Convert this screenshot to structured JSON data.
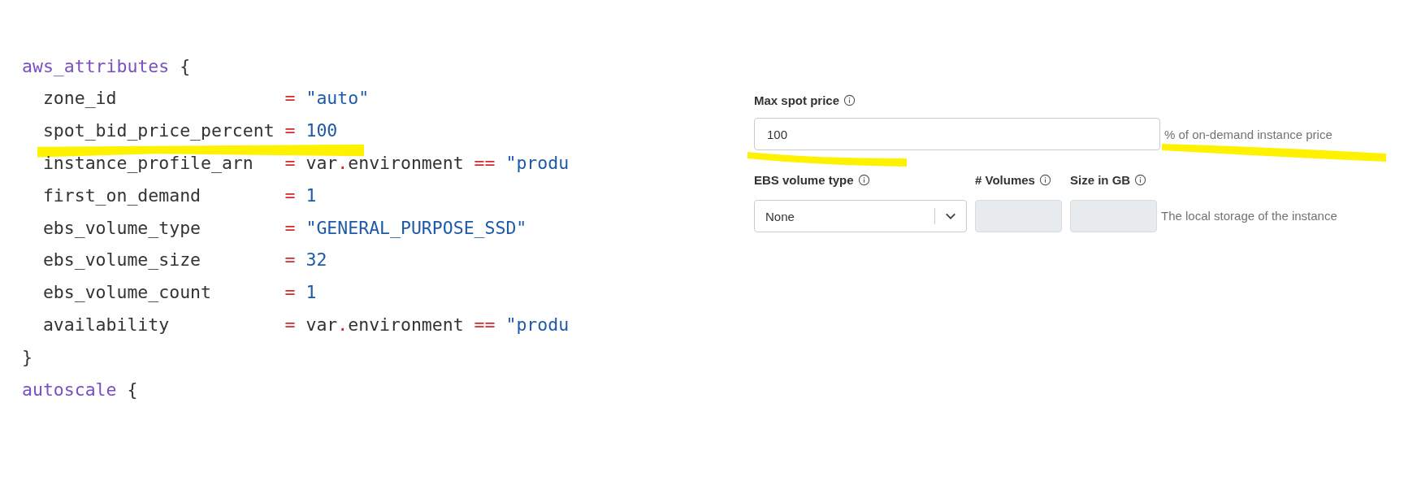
{
  "code": {
    "lines": [
      {
        "kind": "block_open",
        "name": "aws_attributes",
        "brace": "{"
      },
      {
        "kind": "attr",
        "key": "zone_id",
        "op": "=",
        "value": [
          {
            "kind": "string",
            "text": "\"auto\""
          }
        ]
      },
      {
        "kind": "attr",
        "key": "spot_bid_price_percent",
        "op": "=",
        "value": [
          {
            "kind": "number",
            "text": "100"
          }
        ]
      },
      {
        "kind": "attr",
        "key": "instance_profile_arn",
        "op": "=",
        "value": [
          {
            "kind": "plain",
            "text": "var"
          },
          {
            "kind": "operator",
            "text": "."
          },
          {
            "kind": "plain",
            "text": "environment "
          },
          {
            "kind": "operator",
            "text": "=="
          },
          {
            "kind": "string",
            "text": " \"produ"
          }
        ]
      },
      {
        "kind": "attr",
        "key": "first_on_demand",
        "op": "=",
        "value": [
          {
            "kind": "number",
            "text": "1"
          }
        ]
      },
      {
        "kind": "attr",
        "key": "ebs_volume_type",
        "op": "=",
        "value": [
          {
            "kind": "string",
            "text": "\"GENERAL_PURPOSE_SSD\""
          }
        ]
      },
      {
        "kind": "attr",
        "key": "ebs_volume_size",
        "op": "=",
        "value": [
          {
            "kind": "number",
            "text": "32"
          }
        ]
      },
      {
        "kind": "attr",
        "key": "ebs_volume_count",
        "op": "=",
        "value": [
          {
            "kind": "number",
            "text": "1"
          }
        ]
      },
      {
        "kind": "attr",
        "key": "availability",
        "op": "=",
        "value": [
          {
            "kind": "plain",
            "text": "var"
          },
          {
            "kind": "operator",
            "text": "."
          },
          {
            "kind": "plain",
            "text": "environment "
          },
          {
            "kind": "operator",
            "text": "=="
          },
          {
            "kind": "string",
            "text": " \"produ"
          }
        ]
      },
      {
        "kind": "block_close",
        "brace": "}"
      },
      {
        "kind": "block_open",
        "name": "autoscale",
        "brace": "{"
      }
    ]
  },
  "form": {
    "max_spot_price": {
      "label": "Max spot price",
      "value": "100",
      "suffix": "% of on-demand instance price"
    },
    "ebs_volume_type": {
      "label": "EBS volume type",
      "value": "None"
    },
    "volumes": {
      "label": "# Volumes",
      "disabled": true
    },
    "size_in_gb": {
      "label": "Size in GB",
      "disabled": true
    },
    "storage_hint": "The local storage of the instance"
  }
}
